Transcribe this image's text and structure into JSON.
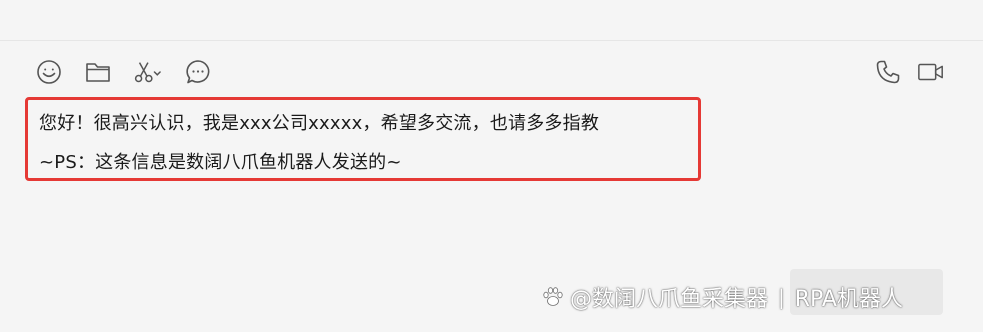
{
  "toolbar": {
    "left_icons": [
      "emoji-icon",
      "folder-icon",
      "scissors-icon",
      "chat-bubble-icon"
    ],
    "right_icons": [
      "phone-icon",
      "video-icon"
    ]
  },
  "message": {
    "line1": "您好！很高兴认识，我是xxx公司xxxxx，希望多交流，也请多多指教",
    "line2": "~PS：这条信息是数阔八爪鱼机器人发送的~"
  },
  "highlight_color": "#e53935",
  "watermark": {
    "brand": "@数阔八爪鱼采集器",
    "separator": "|",
    "product": "RPA机器人"
  }
}
